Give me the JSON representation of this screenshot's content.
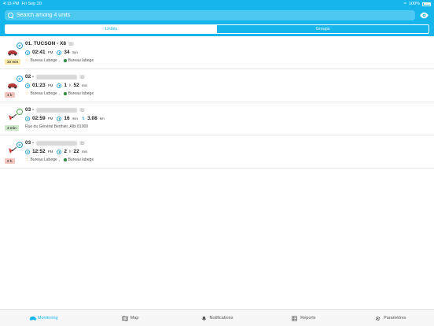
{
  "status_bar": {
    "time": "4:15 PM",
    "date": "Fri Sep 20",
    "battery": "100%"
  },
  "search": {
    "placeholder": "Search among 4 units"
  },
  "segments": {
    "units": "Unités",
    "groups": "Groups"
  },
  "colors": {
    "accent": "#16b6ec",
    "yellow_badge": "#f9e9a6",
    "red_badge": "#f5c6c0",
    "green_badge": "#cde8c9"
  },
  "units": [
    {
      "prefix": "01. TUCSON - X8",
      "redacted": false,
      "tag": "",
      "icon": "car-icon",
      "state": "P",
      "duration": "33 min",
      "duration_color": "yellow",
      "time": "02:41",
      "ampm": "PM",
      "d1": "34",
      "u1": "min",
      "d2": "",
      "u2": "",
      "distance": "",
      "distance_unit": "",
      "loc_primary": "Bureau Labege",
      "loc_secondary": "Bureau labege"
    },
    {
      "prefix": "02 -",
      "redacted": true,
      "tag": "",
      "icon": "car-icon",
      "state": "P",
      "duration": "1 h",
      "duration_color": "red",
      "time": "01:23",
      "ampm": "PM",
      "d1": "1",
      "u1": "h",
      "d2": "52",
      "u2": "min",
      "distance": "",
      "distance_unit": "",
      "loc_primary": "Bureau Labege",
      "loc_secondary": "Bureau labege"
    },
    {
      "prefix": "03 -",
      "redacted": true,
      "tag": "",
      "icon": "pin-icon",
      "state": "",
      "duration": "3 min",
      "duration_color": "green",
      "time": "02:59",
      "ampm": "PM",
      "d1": "16",
      "u1": "min",
      "d2": "",
      "u2": "",
      "distance": "3.08",
      "distance_unit": "km",
      "loc_primary": "Rue du Général Berthier, Albi 81000",
      "loc_secondary": ""
    },
    {
      "prefix": "03 -",
      "redacted": true,
      "tag": "",
      "icon": "pin-icon",
      "state": "P",
      "duration": "2 h",
      "duration_color": "red",
      "time": "12:52",
      "ampm": "PM",
      "d1": "2",
      "u1": "h",
      "d2": "22",
      "u2": "min",
      "distance": "",
      "distance_unit": "",
      "loc_primary": "Bureau Labege",
      "loc_secondary": "Bureau labege"
    }
  ],
  "tabbar": [
    {
      "label": "Monitoring",
      "icon": "car-icon",
      "active": true
    },
    {
      "label": "Map",
      "icon": "map-icon",
      "active": false
    },
    {
      "label": "Notifications",
      "icon": "bell-icon",
      "active": false
    },
    {
      "label": "Reports",
      "icon": "reports-icon",
      "active": false
    },
    {
      "label": "Paramètres",
      "icon": "gear-icon",
      "active": false
    }
  ]
}
